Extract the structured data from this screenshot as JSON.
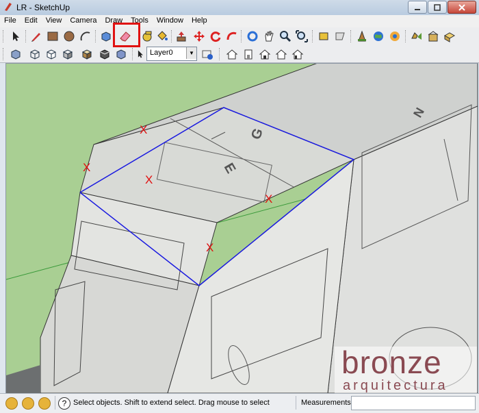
{
  "window": {
    "title": "LR - SketchUp"
  },
  "menu": [
    "File",
    "Edit",
    "View",
    "Camera",
    "Draw",
    "Tools",
    "Window",
    "Help"
  ],
  "toolbar": {
    "row1_icons": [
      "select-icon",
      "pencil-icon",
      "rectangle-icon",
      "circle-icon",
      "arc-icon",
      "make-component-icon",
      "eraser-icon",
      "tape-measure-icon",
      "paint-bucket-icon",
      "push-pull-icon",
      "move-icon",
      "rotate-icon",
      "follow-me-icon",
      "orbit-icon",
      "pan-icon",
      "zoom-icon",
      "zoom-extents-icon",
      "previous-view-icon",
      "next-view-icon",
      "get-models-icon",
      "google-earth-icon",
      "photo-textures-icon",
      "share-model-icon",
      "warehouse-icon"
    ],
    "row2_icons": [
      "xray-icon",
      "wireframe-icon",
      "hidden-line-icon",
      "shaded-icon",
      "shaded-textures-icon",
      "monochrome-icon",
      "iso-icon",
      "top-icon",
      "front-icon",
      "right-icon",
      "back-icon",
      "left-icon"
    ],
    "layer_value": "Layer0"
  },
  "scene": {
    "marks": [
      "X",
      "X",
      "X",
      "X",
      "X",
      "X"
    ]
  },
  "watermark": {
    "main": "bronze",
    "sub": "arquitectura"
  },
  "status": {
    "text": "Select objects. Shift to extend select. Drag mouse to select m",
    "measurements_label": "Measurements",
    "measurements_value": ""
  },
  "colors": {
    "highlight": "#e01010",
    "selection_edge": "#1a1ae0",
    "ground": "#a9cf93"
  }
}
